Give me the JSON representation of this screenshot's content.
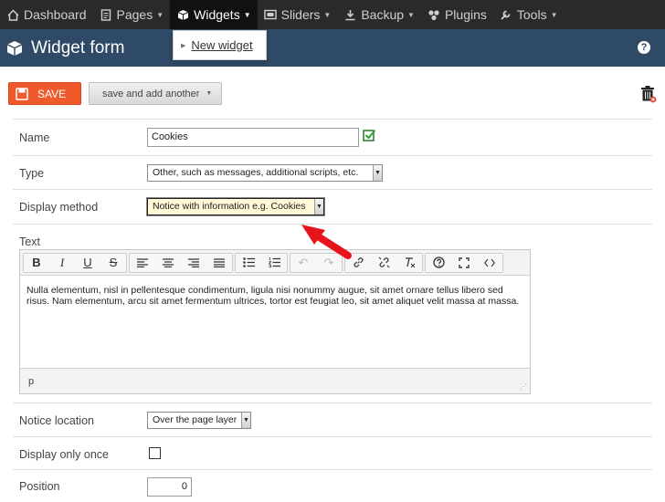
{
  "nav": {
    "items": [
      {
        "label": "Dashboard",
        "icon": "home-icon"
      },
      {
        "label": "Pages",
        "icon": "page-icon"
      },
      {
        "label": "Widgets",
        "icon": "cube-icon"
      },
      {
        "label": "Sliders",
        "icon": "slider-icon"
      },
      {
        "label": "Backup",
        "icon": "download-icon"
      },
      {
        "label": "Plugins",
        "icon": "plugin-icon"
      },
      {
        "label": "Tools",
        "icon": "wrench-icon"
      }
    ],
    "active": "Widgets",
    "dropdown": {
      "item": "New widget"
    }
  },
  "header": {
    "title": "Widget form",
    "help": "?"
  },
  "toolbar": {
    "save_label": "SAVE",
    "save_add_label": "save and add another"
  },
  "form": {
    "name": {
      "label": "Name",
      "value": "Cookies"
    },
    "type": {
      "label": "Type",
      "value": "Other, such as messages, additional scripts, etc."
    },
    "display_method": {
      "label": "Display method",
      "value": "Notice with information e.g. Cookies"
    },
    "text": {
      "label": "Text",
      "content": "Nulla elementum, nisl in pellentesque condimentum, ligula nisi nonummy augue, sit amet ornare tellus libero sed risus. Nam elementum, arcu sit amet fermentum ultrices, tortor est feugiat leo, sit amet aliquet velit massa at massa.",
      "path": "p",
      "toolbar": {
        "bold": "B",
        "italic": "I",
        "underline": "U",
        "strike": "S"
      }
    },
    "notice_location": {
      "label": "Notice location",
      "value": "Over the page layer"
    },
    "display_once": {
      "label": "Display only once",
      "checked": false
    },
    "position": {
      "label": "Position",
      "value": "0"
    }
  },
  "colors": {
    "nav_bg": "#2a2a2a",
    "header_bg": "#2e4a67",
    "save_bg": "#f05a2b",
    "arrow": "#e8141c"
  }
}
